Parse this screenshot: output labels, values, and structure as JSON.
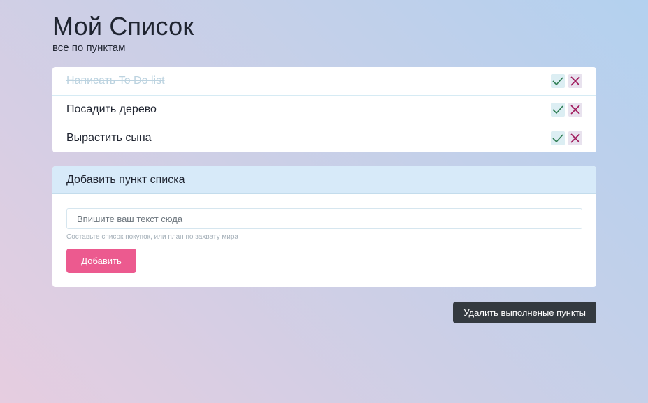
{
  "header": {
    "title": "Мой Список",
    "subtitle": "все по пунктам"
  },
  "list": {
    "items": [
      {
        "text": "Написать To Do list",
        "done": true
      },
      {
        "text": "Посадить дерево",
        "done": false
      },
      {
        "text": "Вырастить сына",
        "done": false
      }
    ],
    "check_icon": "check-icon",
    "delete_icon": "close-icon"
  },
  "add_form": {
    "header": "Добавить пункт списка",
    "input_placeholder": "Впишите ваш текст сюда",
    "input_value": "",
    "help_text": "Составьте список покупок, или план по захвату мира",
    "submit_label": "Добавить"
  },
  "footer": {
    "delete_completed_label": "Удалить выполненые пункты"
  },
  "colors": {
    "check": "#2e7d52",
    "cross": "#a0185a",
    "accent": "#ec5a8f",
    "dark_button": "#343a40"
  }
}
